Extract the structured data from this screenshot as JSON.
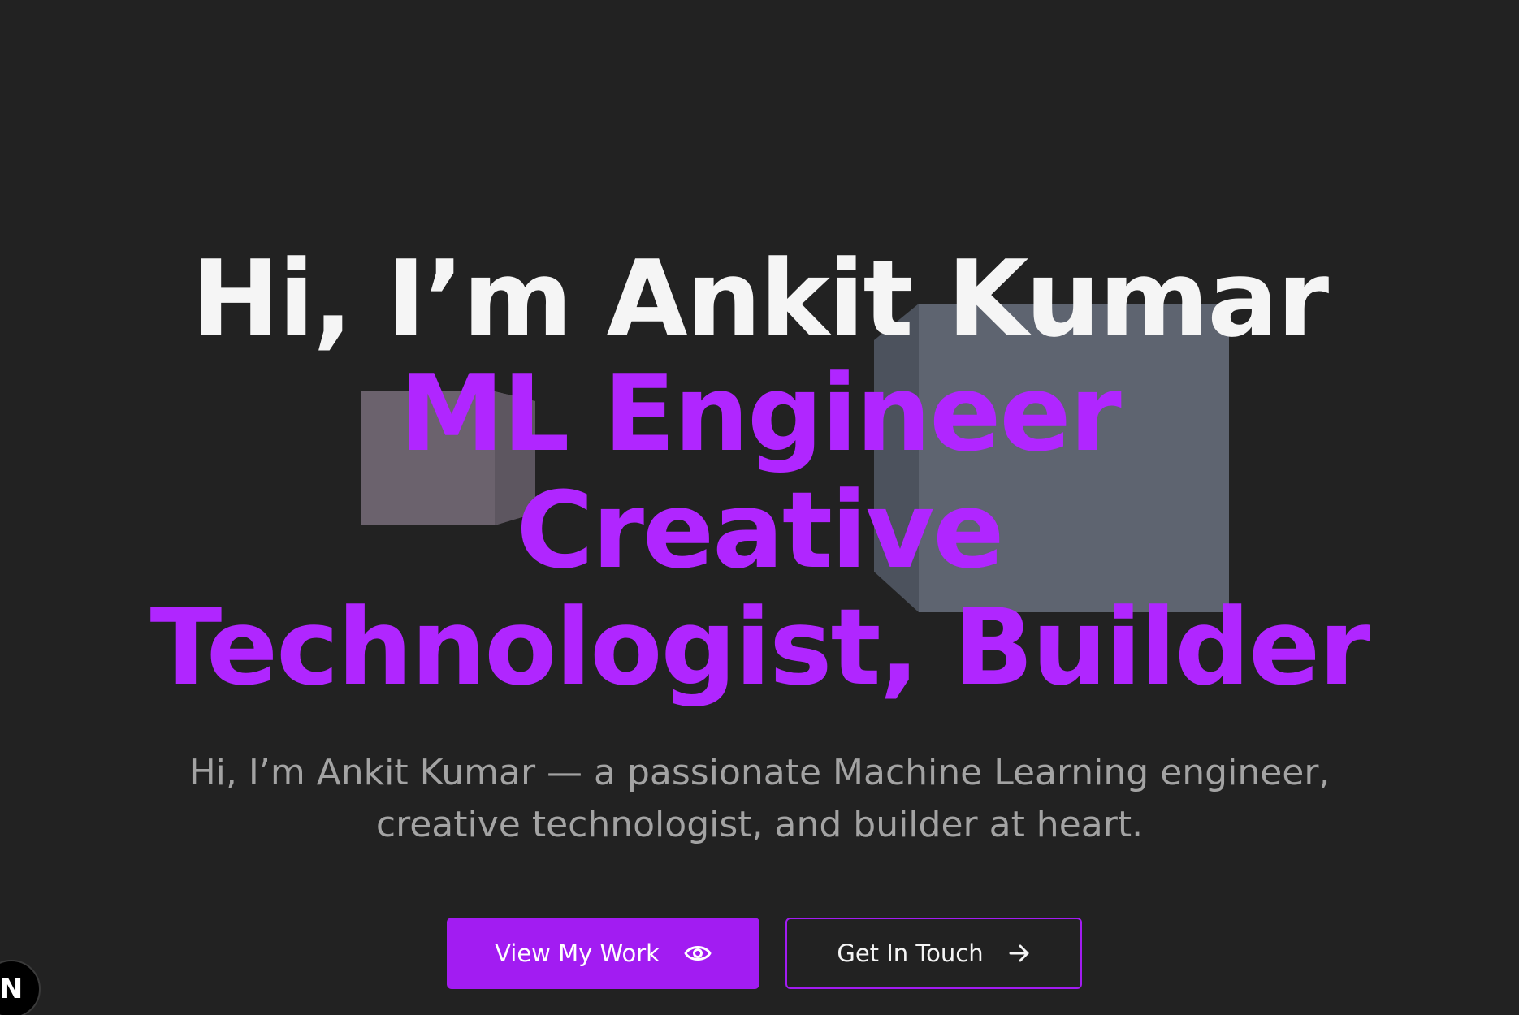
{
  "hero": {
    "title": "Hi, I’m Ankit Kumar",
    "roles": [
      "ML Engineer",
      "Creative",
      "Technologist, Builder"
    ],
    "description_line1": "Hi, I’m Ankit Kumar — a passionate Machine Learning engineer,",
    "description_line2": "creative technologist, and builder at heart."
  },
  "buttons": {
    "primary_label": "View My Work",
    "primary_icon": "eye-icon",
    "secondary_label": "Get In Touch",
    "secondary_icon": "arrow-right-icon"
  },
  "badge": {
    "label": "N"
  },
  "colors": {
    "background": "#222222",
    "accent": "#b026ff",
    "button": "#a21cf2",
    "title": "#f5f5f5",
    "muted_text": "#a3a3a3"
  }
}
